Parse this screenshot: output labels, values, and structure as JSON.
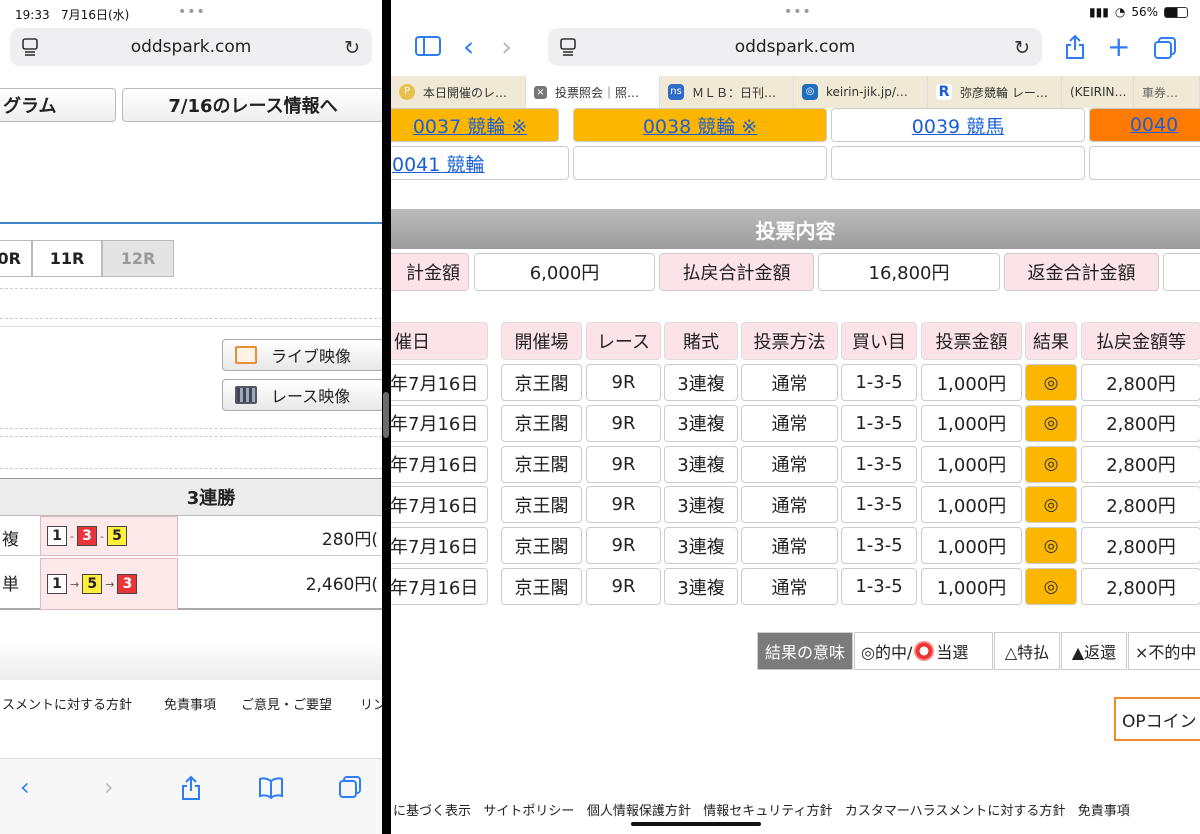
{
  "left": {
    "status_time": "19:33",
    "status_date": "7月16日(水)",
    "url": "oddspark.com",
    "nav_buttons": [
      "グラム",
      "7/16のレース情報へ"
    ],
    "race_tabs": [
      "0R",
      "11R",
      "12R"
    ],
    "video_buttons": [
      "ライブ映像",
      "レース映像"
    ],
    "section_title": "3連勝",
    "results": [
      {
        "label": "複",
        "nums": [
          "1",
          "3",
          "5"
        ],
        "seps": [
          "-",
          "-"
        ],
        "amount": "280円("
      },
      {
        "label": "単",
        "nums": [
          "1",
          "5",
          "3"
        ],
        "seps": [
          "→",
          "→"
        ],
        "amount": "2,460円("
      }
    ],
    "footer": [
      "スメントに対する方針",
      "免責事項",
      "ご意見・ご要望",
      "リン"
    ]
  },
  "right": {
    "battery": "56%",
    "url": "oddspark.com",
    "tabs": [
      {
        "label": "本日開催のレ…",
        "icon": "P"
      },
      {
        "label": "投票照会｜照…",
        "icon": "×"
      },
      {
        "label": "ＭＬＢ：日刊…",
        "icon": "ns"
      },
      {
        "label": "keirin-jik.jp/…",
        "icon": "◎"
      },
      {
        "label": "弥彦競輪 レー…",
        "icon": "R"
      },
      {
        "label": "(KEIRIN…",
        "icon": ""
      },
      {
        "label": "車券…",
        "icon": ""
      }
    ],
    "venues_row1": [
      "0037 競輪 ※",
      "0038 競輪 ※",
      "0039 競馬",
      "0040"
    ],
    "venues_row2": [
      "0041 競輪",
      "",
      "",
      ""
    ],
    "section_title": "投票内容",
    "summary": {
      "total_label": "計金額",
      "total_value": "6,000円",
      "payout_label": "払戻合計金額",
      "payout_value": "16,800円",
      "refund_label": "返金合計金額",
      "refund_value": ""
    },
    "headers": [
      "催日",
      "開催場",
      "レース",
      "賭式",
      "投票方法",
      "買い目",
      "投票金額",
      "結果",
      "払戻金額等"
    ],
    "rows": [
      [
        "年7月16日",
        "京王閣",
        "9R",
        "3連複",
        "通常",
        "1-3-5",
        "1,000円",
        "◎",
        "2,800円"
      ],
      [
        "年7月16日",
        "京王閣",
        "9R",
        "3連複",
        "通常",
        "1-3-5",
        "1,000円",
        "◎",
        "2,800円"
      ],
      [
        "年7月16日",
        "京王閣",
        "9R",
        "3連複",
        "通常",
        "1-3-5",
        "1,000円",
        "◎",
        "2,800円"
      ],
      [
        "年7月16日",
        "京王閣",
        "9R",
        "3連複",
        "通常",
        "1-3-5",
        "1,000円",
        "◎",
        "2,800円"
      ],
      [
        "年7月16日",
        "京王閣",
        "9R",
        "3連複",
        "通常",
        "1-3-5",
        "1,000円",
        "◎",
        "2,800円"
      ],
      [
        "年7月16日",
        "京王閣",
        "9R",
        "3連複",
        "通常",
        "1-3-5",
        "1,000円",
        "◎",
        "2,800円"
      ]
    ],
    "legend": [
      "結果の意味",
      "◎的中/",
      "当選",
      "△特払",
      "▲返還",
      "×不的中"
    ],
    "op_button": "OPコイン",
    "footer": [
      "に基づく表示",
      "サイトポリシー",
      "個人情報保護方針",
      "情報セキュリティ方針",
      "カスタマーハラスメントに対する方針",
      "免責事項"
    ]
  }
}
